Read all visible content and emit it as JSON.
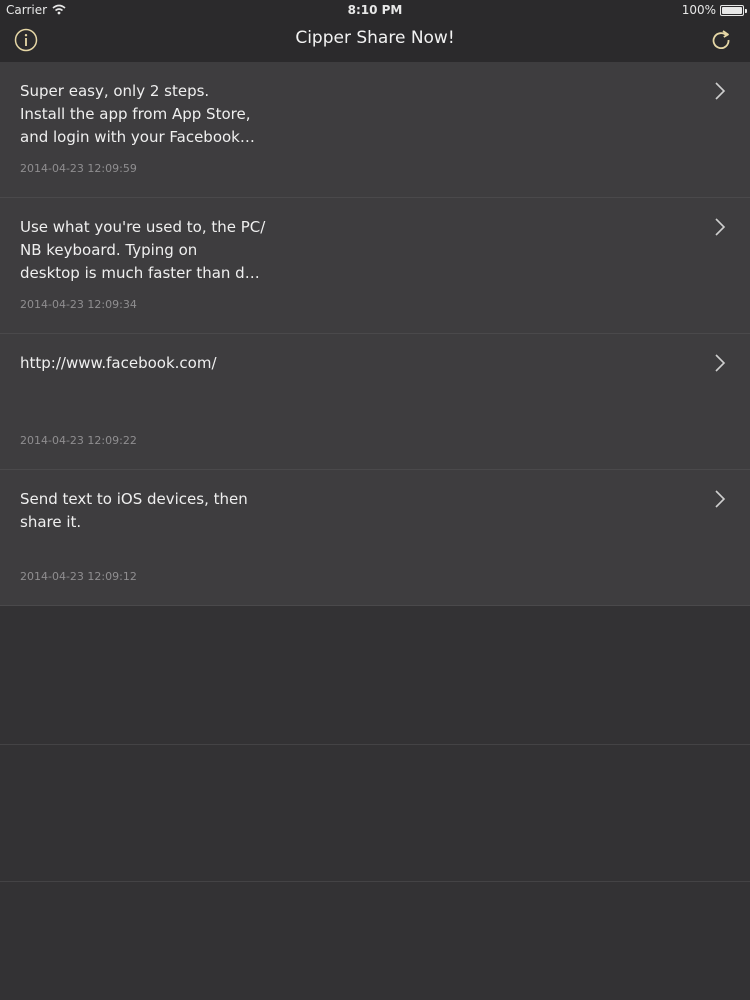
{
  "status_bar": {
    "carrier": "Carrier",
    "time": "8:10 PM",
    "battery": "100%"
  },
  "nav": {
    "title": "Cipper Share Now!",
    "info_icon": "info-icon",
    "refresh_icon": "refresh-icon"
  },
  "items": [
    {
      "text": "Super easy, only 2 steps.\nInstall the app from App Store,\nand login with your Facebook…",
      "date": "2014-04-23 12:09:59"
    },
    {
      "text": "Use what you're used to, the PC/\nNB keyboard. Typing on\ndesktop is much faster than d…",
      "date": "2014-04-23 12:09:34"
    },
    {
      "text": "http://www.facebook.com/",
      "date": "2014-04-23 12:09:22"
    },
    {
      "text": "Send text to iOS devices, then\nshare it.",
      "date": "2014-04-23 12:09:12"
    }
  ],
  "colors": {
    "background": "#333234",
    "row_background": "#3e3d3f",
    "accent_icon": "#e6d7a6"
  }
}
